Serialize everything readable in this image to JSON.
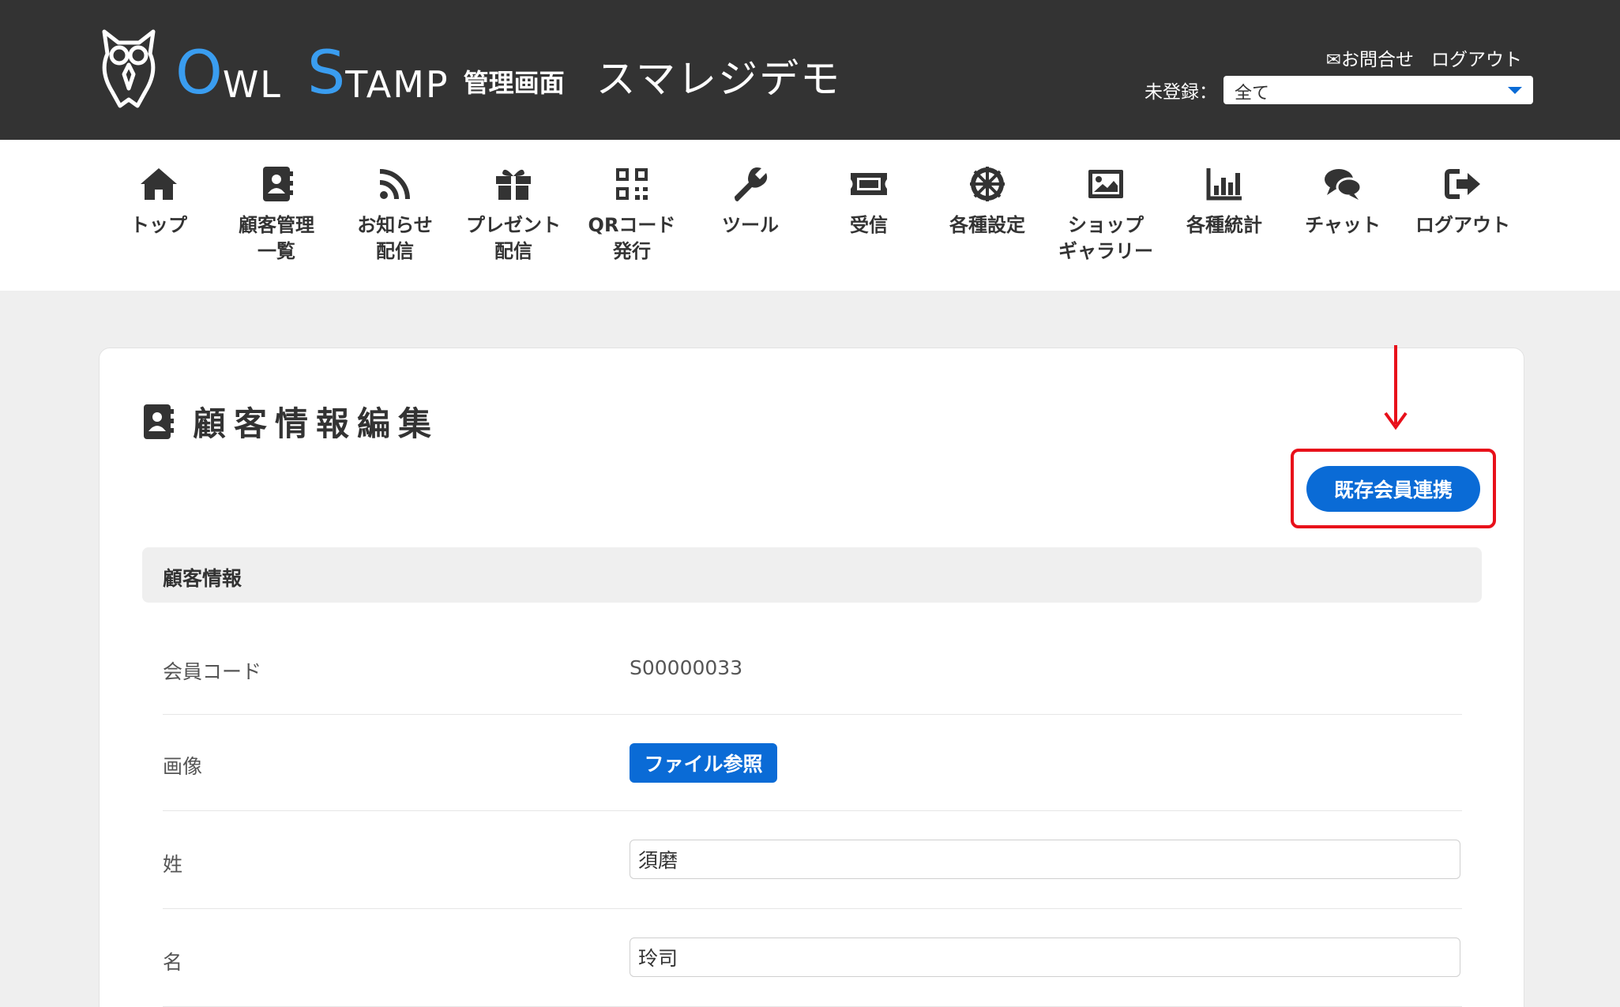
{
  "header": {
    "brand": {
      "o": "O",
      "wl": "WL",
      "s": "S",
      "tamp": "TAMP",
      "kanri": "管理画面",
      "shop": "スマレジデモ"
    },
    "contact_label": "✉お問合せ",
    "logout_label": "ログアウト",
    "unregistered_label": "未登録：",
    "unregistered_value": "全て"
  },
  "nav": {
    "items": [
      {
        "line1": "トップ",
        "line2": "",
        "icon": "home-icon"
      },
      {
        "line1": "顧客管理",
        "line2": "一覧",
        "icon": "address-book-icon"
      },
      {
        "line1": "お知らせ",
        "line2": "配信",
        "icon": "rss-icon"
      },
      {
        "line1": "プレゼント",
        "line2": "配信",
        "icon": "gift-icon"
      },
      {
        "line1": "QRコード",
        "line2": "発行",
        "icon": "qrcode-icon"
      },
      {
        "line1": "ツール",
        "line2": "",
        "icon": "wrench-icon"
      },
      {
        "line1": "受信",
        "line2": "",
        "icon": "ticket-icon"
      },
      {
        "line1": "各種設定",
        "line2": "",
        "icon": "gear-icon"
      },
      {
        "line1": "ショップ",
        "line2": "ギャラリー",
        "icon": "image-icon"
      },
      {
        "line1": "各種統計",
        "line2": "",
        "icon": "bar-chart-icon"
      },
      {
        "line1": "チャット",
        "line2": "",
        "icon": "chat-icon"
      },
      {
        "line1": "ログアウト",
        "line2": "",
        "icon": "sign-out-icon"
      }
    ]
  },
  "page": {
    "title": "顧客情報編集",
    "link_button_label": "既存会員連携",
    "section_title": "顧客情報",
    "colors": {
      "accent": "#0a6bd6",
      "highlight": "#e8101a",
      "header_bg": "#333333",
      "brand_blue": "#3a9df0"
    },
    "fields": {
      "member_code_label": "会員コード",
      "member_code_value": "S00000033",
      "image_label": "画像",
      "file_button_label": "ファイル参照",
      "last_name_label": "姓",
      "last_name_value": "須磨",
      "first_name_label": "名",
      "first_name_value": "玲司"
    }
  }
}
